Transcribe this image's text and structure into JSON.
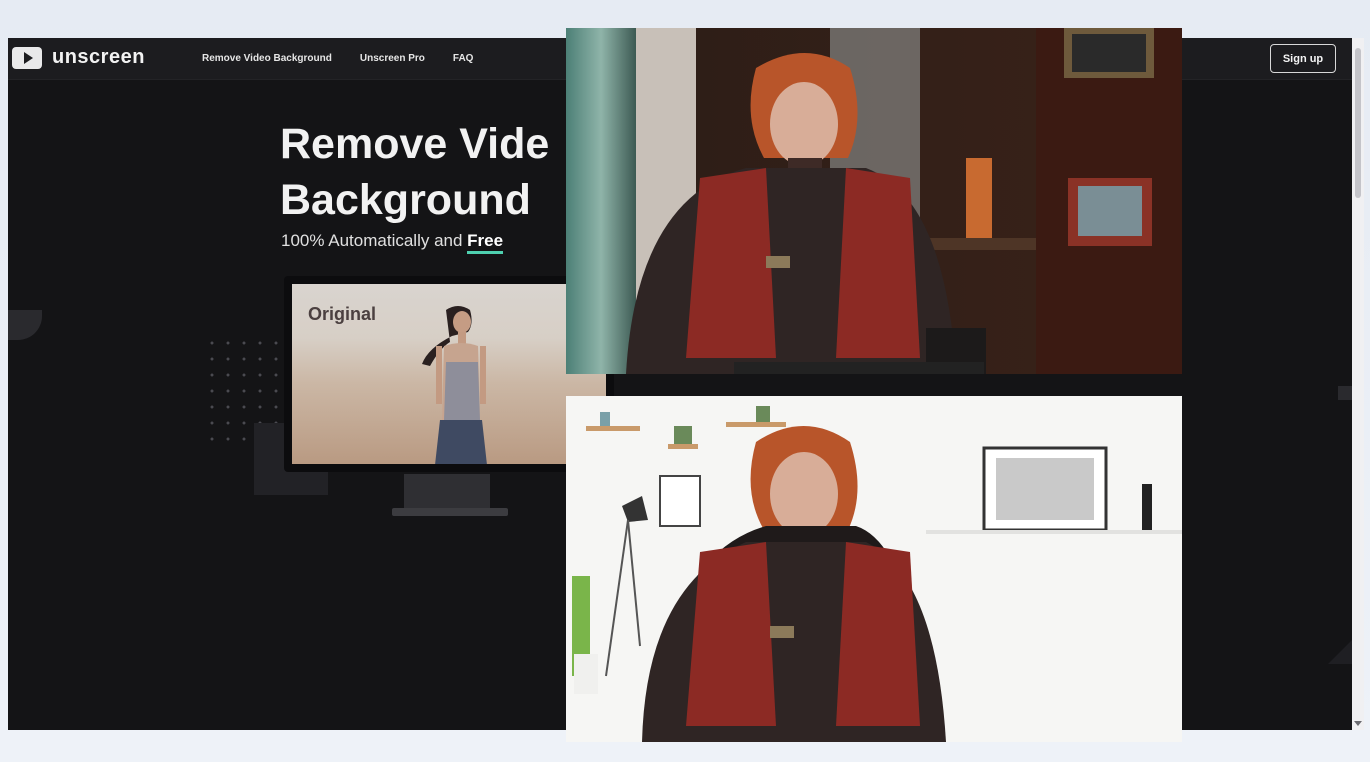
{
  "logo": {
    "text": "unscreen",
    "icon": "play-icon"
  },
  "nav": {
    "items": [
      {
        "label": "Remove Video Background"
      },
      {
        "label": "Unscreen Pro"
      },
      {
        "label": "FAQ"
      }
    ]
  },
  "signup": {
    "label": "Sign up"
  },
  "hero": {
    "title_line1": "Remove Vide",
    "title_line2": "Background",
    "subtitle_prefix": "100% Automatically and ",
    "subtitle_highlight": "Free"
  },
  "demo": {
    "label": "Original"
  },
  "colors": {
    "page_bg": "#141416",
    "accent_underline": "#4fd1b0",
    "text_primary": "#f2f2f2"
  }
}
